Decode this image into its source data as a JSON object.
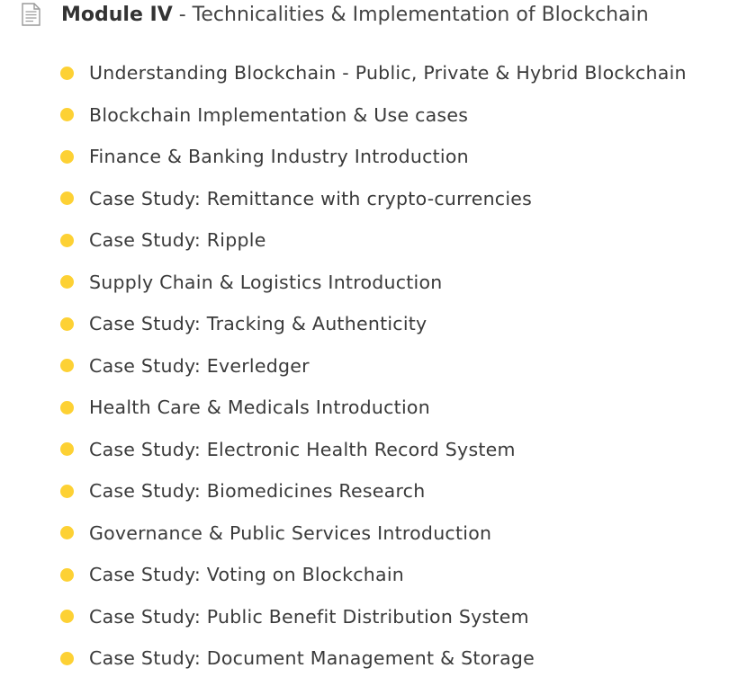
{
  "module": {
    "icon": "document-icon",
    "title_bold": "Module IV",
    "title_rest": " - Technicalities & Implementation of Blockchain"
  },
  "colors": {
    "bullet": "#fdd134",
    "text": "#333333",
    "icon": "#9a9a9a"
  },
  "topics": [
    "Understanding Blockchain - Public, Private & Hybrid Blockchain",
    "Blockchain Implementation & Use cases",
    "Finance & Banking Industry Introduction",
    "Case Study: Remittance with crypto-currencies",
    "Case Study: Ripple",
    "Supply Chain & Logistics Introduction",
    "Case Study: Tracking & Authenticity",
    "Case Study: Everledger",
    "Health Care & Medicals Introduction",
    "Case Study: Electronic Health Record System",
    "Case Study: Biomedicines Research",
    "Governance & Public Services Introduction",
    "Case Study: Voting on Blockchain",
    "Case Study: Public Benefit Distribution System",
    "Case Study: Document Management & Storage"
  ]
}
